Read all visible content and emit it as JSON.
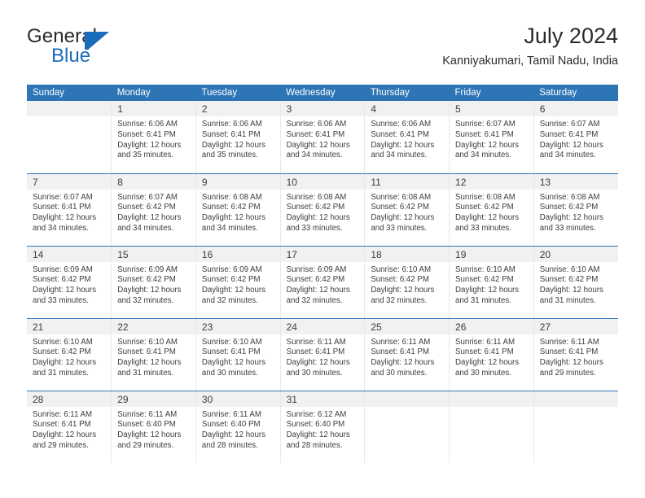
{
  "brand": {
    "name_top": "General",
    "name_bottom": "Blue",
    "accent_color": "#1a6dbb"
  },
  "header": {
    "title": "July 2024",
    "subtitle": "Kanniyakumari, Tamil Nadu, India",
    "header_bg": "#2e75b6",
    "daynum_bg": "#f1f1f1"
  },
  "weekdays": [
    "Sunday",
    "Monday",
    "Tuesday",
    "Wednesday",
    "Thursday",
    "Friday",
    "Saturday"
  ],
  "weeks": [
    [
      {
        "day": "",
        "sunrise": "",
        "sunset": "",
        "daylight1": "",
        "daylight2": "",
        "empty": true
      },
      {
        "day": "1",
        "sunrise": "Sunrise: 6:06 AM",
        "sunset": "Sunset: 6:41 PM",
        "daylight1": "Daylight: 12 hours",
        "daylight2": "and 35 minutes."
      },
      {
        "day": "2",
        "sunrise": "Sunrise: 6:06 AM",
        "sunset": "Sunset: 6:41 PM",
        "daylight1": "Daylight: 12 hours",
        "daylight2": "and 35 minutes."
      },
      {
        "day": "3",
        "sunrise": "Sunrise: 6:06 AM",
        "sunset": "Sunset: 6:41 PM",
        "daylight1": "Daylight: 12 hours",
        "daylight2": "and 34 minutes."
      },
      {
        "day": "4",
        "sunrise": "Sunrise: 6:06 AM",
        "sunset": "Sunset: 6:41 PM",
        "daylight1": "Daylight: 12 hours",
        "daylight2": "and 34 minutes."
      },
      {
        "day": "5",
        "sunrise": "Sunrise: 6:07 AM",
        "sunset": "Sunset: 6:41 PM",
        "daylight1": "Daylight: 12 hours",
        "daylight2": "and 34 minutes."
      },
      {
        "day": "6",
        "sunrise": "Sunrise: 6:07 AM",
        "sunset": "Sunset: 6:41 PM",
        "daylight1": "Daylight: 12 hours",
        "daylight2": "and 34 minutes."
      }
    ],
    [
      {
        "day": "7",
        "sunrise": "Sunrise: 6:07 AM",
        "sunset": "Sunset: 6:41 PM",
        "daylight1": "Daylight: 12 hours",
        "daylight2": "and 34 minutes."
      },
      {
        "day": "8",
        "sunrise": "Sunrise: 6:07 AM",
        "sunset": "Sunset: 6:42 PM",
        "daylight1": "Daylight: 12 hours",
        "daylight2": "and 34 minutes."
      },
      {
        "day": "9",
        "sunrise": "Sunrise: 6:08 AM",
        "sunset": "Sunset: 6:42 PM",
        "daylight1": "Daylight: 12 hours",
        "daylight2": "and 34 minutes."
      },
      {
        "day": "10",
        "sunrise": "Sunrise: 6:08 AM",
        "sunset": "Sunset: 6:42 PM",
        "daylight1": "Daylight: 12 hours",
        "daylight2": "and 33 minutes."
      },
      {
        "day": "11",
        "sunrise": "Sunrise: 6:08 AM",
        "sunset": "Sunset: 6:42 PM",
        "daylight1": "Daylight: 12 hours",
        "daylight2": "and 33 minutes."
      },
      {
        "day": "12",
        "sunrise": "Sunrise: 6:08 AM",
        "sunset": "Sunset: 6:42 PM",
        "daylight1": "Daylight: 12 hours",
        "daylight2": "and 33 minutes."
      },
      {
        "day": "13",
        "sunrise": "Sunrise: 6:08 AM",
        "sunset": "Sunset: 6:42 PM",
        "daylight1": "Daylight: 12 hours",
        "daylight2": "and 33 minutes."
      }
    ],
    [
      {
        "day": "14",
        "sunrise": "Sunrise: 6:09 AM",
        "sunset": "Sunset: 6:42 PM",
        "daylight1": "Daylight: 12 hours",
        "daylight2": "and 33 minutes."
      },
      {
        "day": "15",
        "sunrise": "Sunrise: 6:09 AM",
        "sunset": "Sunset: 6:42 PM",
        "daylight1": "Daylight: 12 hours",
        "daylight2": "and 32 minutes."
      },
      {
        "day": "16",
        "sunrise": "Sunrise: 6:09 AM",
        "sunset": "Sunset: 6:42 PM",
        "daylight1": "Daylight: 12 hours",
        "daylight2": "and 32 minutes."
      },
      {
        "day": "17",
        "sunrise": "Sunrise: 6:09 AM",
        "sunset": "Sunset: 6:42 PM",
        "daylight1": "Daylight: 12 hours",
        "daylight2": "and 32 minutes."
      },
      {
        "day": "18",
        "sunrise": "Sunrise: 6:10 AM",
        "sunset": "Sunset: 6:42 PM",
        "daylight1": "Daylight: 12 hours",
        "daylight2": "and 32 minutes."
      },
      {
        "day": "19",
        "sunrise": "Sunrise: 6:10 AM",
        "sunset": "Sunset: 6:42 PM",
        "daylight1": "Daylight: 12 hours",
        "daylight2": "and 31 minutes."
      },
      {
        "day": "20",
        "sunrise": "Sunrise: 6:10 AM",
        "sunset": "Sunset: 6:42 PM",
        "daylight1": "Daylight: 12 hours",
        "daylight2": "and 31 minutes."
      }
    ],
    [
      {
        "day": "21",
        "sunrise": "Sunrise: 6:10 AM",
        "sunset": "Sunset: 6:42 PM",
        "daylight1": "Daylight: 12 hours",
        "daylight2": "and 31 minutes."
      },
      {
        "day": "22",
        "sunrise": "Sunrise: 6:10 AM",
        "sunset": "Sunset: 6:41 PM",
        "daylight1": "Daylight: 12 hours",
        "daylight2": "and 31 minutes."
      },
      {
        "day": "23",
        "sunrise": "Sunrise: 6:10 AM",
        "sunset": "Sunset: 6:41 PM",
        "daylight1": "Daylight: 12 hours",
        "daylight2": "and 30 minutes."
      },
      {
        "day": "24",
        "sunrise": "Sunrise: 6:11 AM",
        "sunset": "Sunset: 6:41 PM",
        "daylight1": "Daylight: 12 hours",
        "daylight2": "and 30 minutes."
      },
      {
        "day": "25",
        "sunrise": "Sunrise: 6:11 AM",
        "sunset": "Sunset: 6:41 PM",
        "daylight1": "Daylight: 12 hours",
        "daylight2": "and 30 minutes."
      },
      {
        "day": "26",
        "sunrise": "Sunrise: 6:11 AM",
        "sunset": "Sunset: 6:41 PM",
        "daylight1": "Daylight: 12 hours",
        "daylight2": "and 30 minutes."
      },
      {
        "day": "27",
        "sunrise": "Sunrise: 6:11 AM",
        "sunset": "Sunset: 6:41 PM",
        "daylight1": "Daylight: 12 hours",
        "daylight2": "and 29 minutes."
      }
    ],
    [
      {
        "day": "28",
        "sunrise": "Sunrise: 6:11 AM",
        "sunset": "Sunset: 6:41 PM",
        "daylight1": "Daylight: 12 hours",
        "daylight2": "and 29 minutes."
      },
      {
        "day": "29",
        "sunrise": "Sunrise: 6:11 AM",
        "sunset": "Sunset: 6:40 PM",
        "daylight1": "Daylight: 12 hours",
        "daylight2": "and 29 minutes."
      },
      {
        "day": "30",
        "sunrise": "Sunrise: 6:11 AM",
        "sunset": "Sunset: 6:40 PM",
        "daylight1": "Daylight: 12 hours",
        "daylight2": "and 28 minutes."
      },
      {
        "day": "31",
        "sunrise": "Sunrise: 6:12 AM",
        "sunset": "Sunset: 6:40 PM",
        "daylight1": "Daylight: 12 hours",
        "daylight2": "and 28 minutes."
      },
      {
        "day": "",
        "sunrise": "",
        "sunset": "",
        "daylight1": "",
        "daylight2": "",
        "empty": true
      },
      {
        "day": "",
        "sunrise": "",
        "sunset": "",
        "daylight1": "",
        "daylight2": "",
        "empty": true
      },
      {
        "day": "",
        "sunrise": "",
        "sunset": "",
        "daylight1": "",
        "daylight2": "",
        "empty": true
      }
    ]
  ]
}
